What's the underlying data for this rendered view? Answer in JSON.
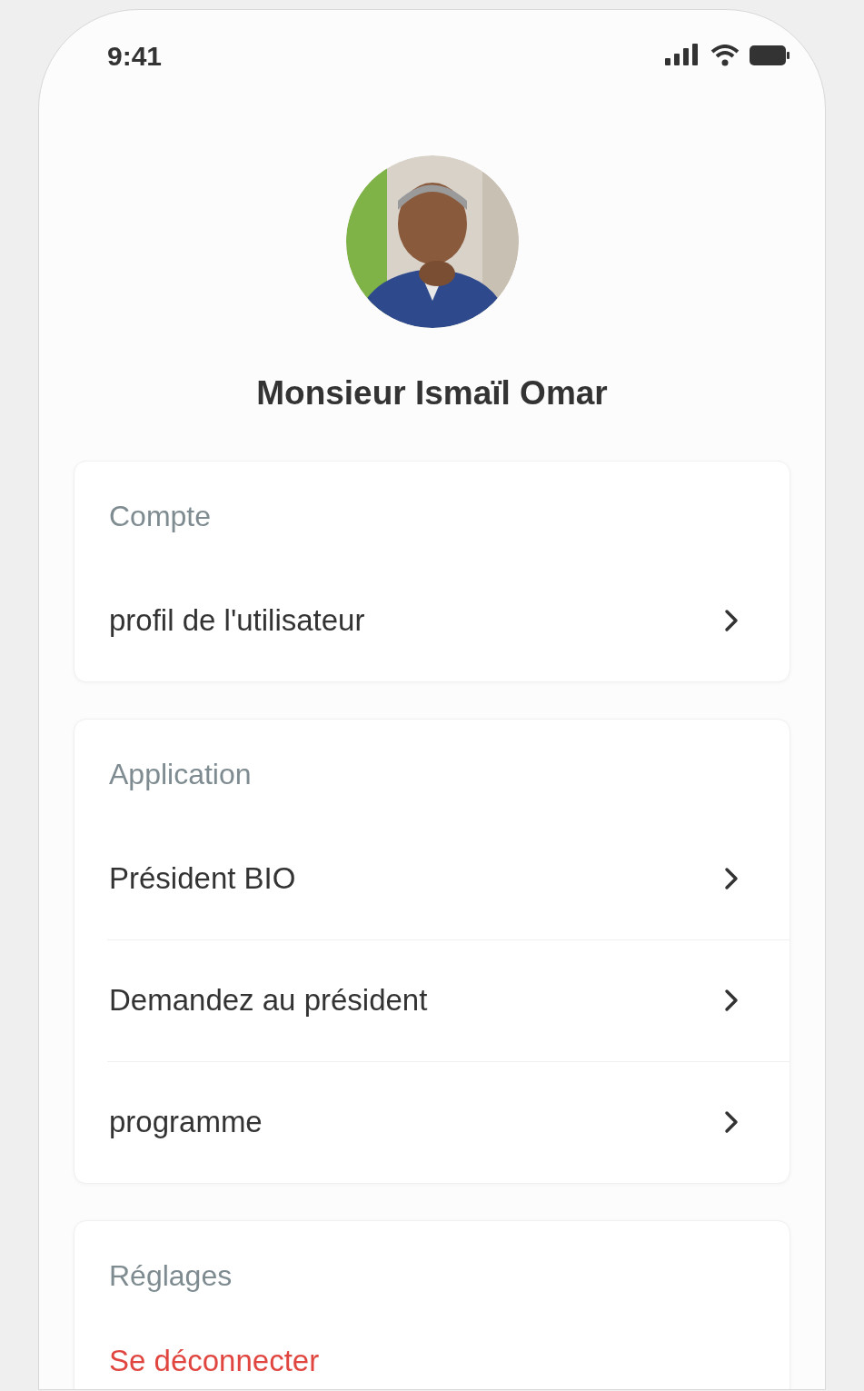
{
  "status_bar": {
    "time": "9:41"
  },
  "profile": {
    "name": "Monsieur Ismaïl Omar"
  },
  "sections": [
    {
      "title": "Compte",
      "items": [
        {
          "label": "profil de l'utilisateur",
          "kind": "link"
        }
      ]
    },
    {
      "title": "Application",
      "items": [
        {
          "label": "Président BIO",
          "kind": "link"
        },
        {
          "label": "Demandez au président",
          "kind": "link"
        },
        {
          "label": "programme",
          "kind": "link"
        }
      ]
    },
    {
      "title": "Réglages",
      "items": [
        {
          "label": "Se déconnecter",
          "kind": "danger"
        }
      ]
    }
  ]
}
